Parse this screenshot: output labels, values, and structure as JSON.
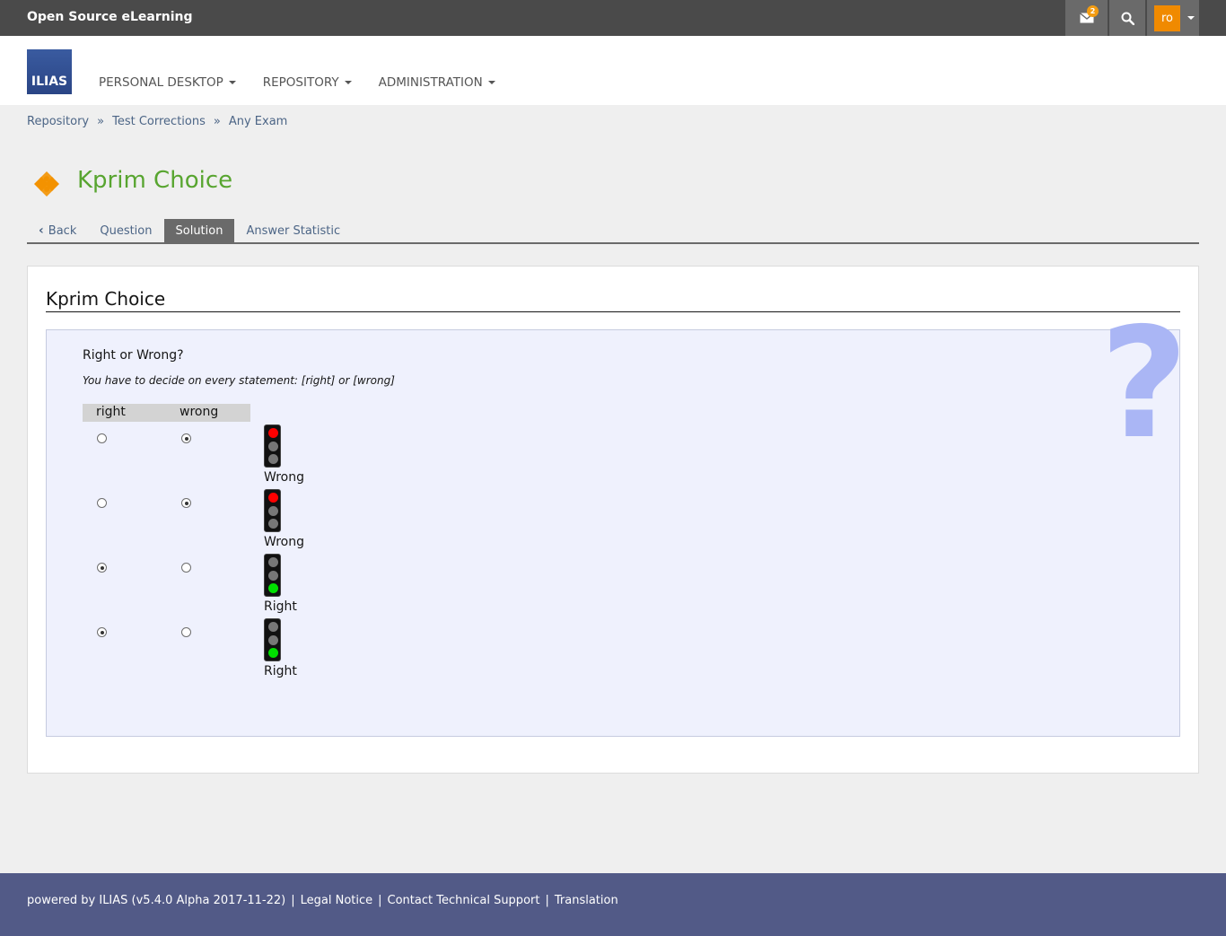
{
  "topbar": {
    "brand": "Open Source eLearning",
    "mail_badge": "2",
    "user_initials": "ro"
  },
  "header": {
    "logo_text": "ILIAS",
    "nav": [
      {
        "label": "PERSONAL DESKTOP"
      },
      {
        "label": "REPOSITORY"
      },
      {
        "label": "ADMINISTRATION"
      }
    ]
  },
  "breadcrumb": [
    "Repository",
    "Test Corrections",
    "Any Exam"
  ],
  "breadcrumb_sep": "»",
  "page": {
    "title": "Kprim Choice"
  },
  "tabs": [
    {
      "label": "Back",
      "active": false
    },
    {
      "label": "Question",
      "active": false
    },
    {
      "label": "Solution",
      "active": true
    },
    {
      "label": "Answer Statistic",
      "active": false
    }
  ],
  "panel": {
    "title": "Kprim Choice",
    "question_mark": "?",
    "question": "Right or Wrong?",
    "instruction": "You have to decide on every statement: [right] or [wrong]",
    "col_right": "right",
    "col_wrong": "wrong",
    "rows": [
      {
        "selected": "wrong",
        "verdict": "Wrong",
        "light": "red"
      },
      {
        "selected": "wrong",
        "verdict": "Wrong",
        "light": "red"
      },
      {
        "selected": "right",
        "verdict": "Right",
        "light": "green"
      },
      {
        "selected": "right",
        "verdict": "Right",
        "light": "green"
      }
    ]
  },
  "footer": {
    "powered": "powered by ILIAS (v5.4.0 Alpha 2017-11-22)",
    "links": [
      "Legal Notice",
      "Contact Technical Support",
      "Translation"
    ],
    "sep": "|"
  },
  "colors": {
    "title_green": "#58a530",
    "link_blue": "#4c6586",
    "footer_bg": "#525a87",
    "avatar_orange": "#f08a00"
  }
}
